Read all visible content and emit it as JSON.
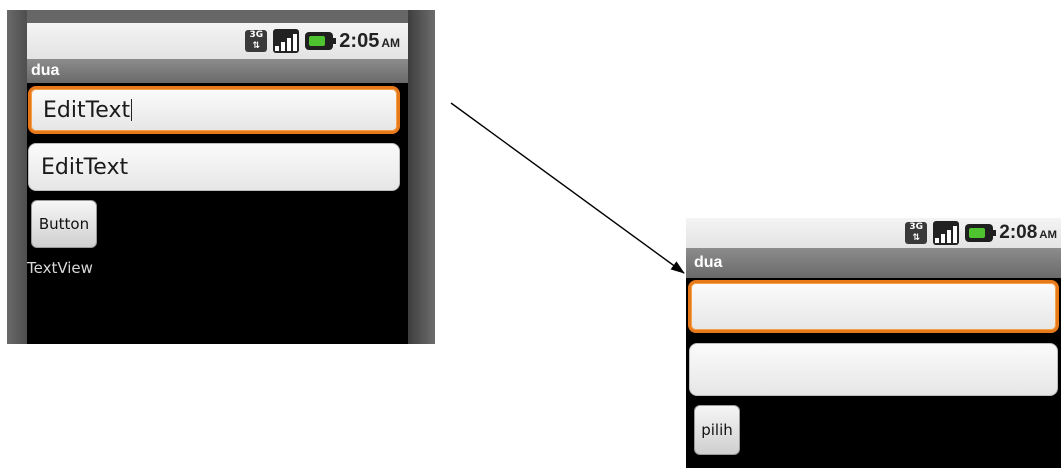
{
  "left_screen": {
    "status_time": "2:05",
    "status_ampm": "AM",
    "status_icons": [
      "3g-icon",
      "signal-icon",
      "battery-icon"
    ],
    "title": "dua",
    "edit1_text": "EditText",
    "edit2_text": "EditText",
    "button_label": "Button",
    "textview": "TextView"
  },
  "right_screen": {
    "status_time": "2:08",
    "status_ampm": "AM",
    "status_icons": [
      "3g-icon",
      "signal-icon",
      "battery-icon"
    ],
    "title": "dua",
    "edit1_text": "",
    "edit2_text": "",
    "button_label": "pilih"
  },
  "colors": {
    "focus_border": "#e8791a",
    "title_bar": "#7a7a7a",
    "battery": "#4fc32f"
  }
}
